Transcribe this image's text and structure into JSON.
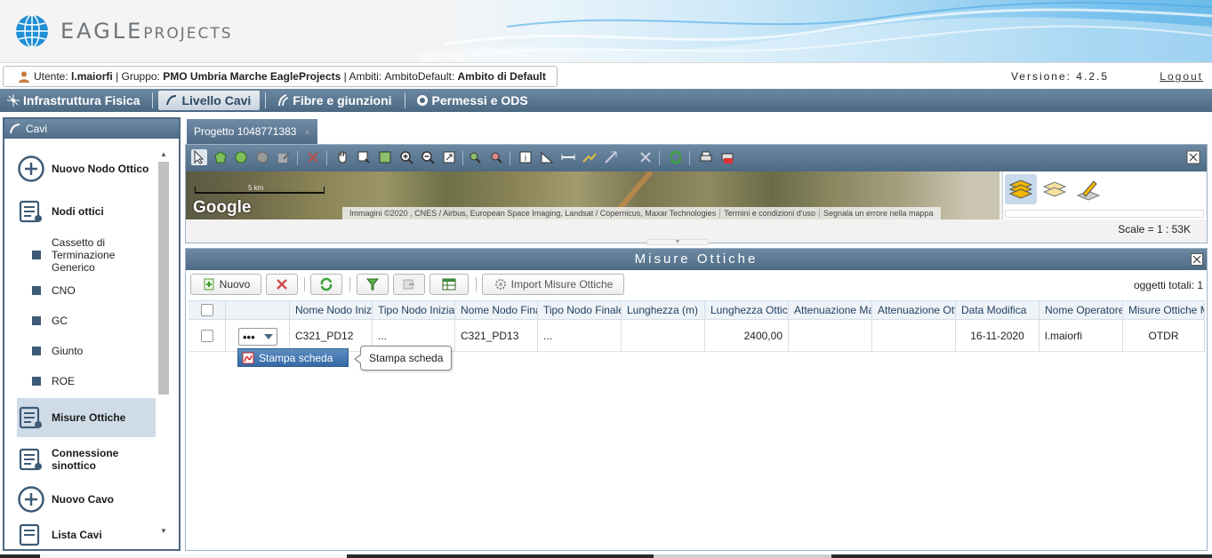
{
  "app": {
    "logo_main": "EAGLE",
    "logo_sub": "PROJECTS"
  },
  "userbar": {
    "utente_label": "Utente:",
    "utente": "l.maiorfi",
    "gruppo_label": "| Gruppo:",
    "gruppo": "PMO Umbria Marche EagleProjects",
    "ambiti_label": "| Ambiti:",
    "ambito_default_label": "AmbitoDefault:",
    "ambito_default": "Ambito di Default",
    "version": "Versione: 4.2.5",
    "logout": "Logout"
  },
  "menu": {
    "items": [
      {
        "label": "Infrastruttura Fisica",
        "icon": "network-icon"
      },
      {
        "label": "Livello Cavi",
        "icon": "cable-icon"
      },
      {
        "label": "Fibre e giunzioni",
        "icon": "fiber-icon"
      },
      {
        "label": "Permessi e ODS",
        "icon": "permit-icon"
      }
    ],
    "active": "Livello Cavi"
  },
  "leftpanel": {
    "title": "Cavi",
    "items": [
      {
        "label": "Nuovo Nodo Ottico",
        "type": "node",
        "icon": "add-circle-icon"
      },
      {
        "label": "Nodi ottici",
        "type": "node",
        "icon": "list-icon"
      },
      {
        "label": "Cassetto di Terminazione Generico",
        "type": "sub"
      },
      {
        "label": "CNO",
        "type": "sub"
      },
      {
        "label": "GC",
        "type": "sub"
      },
      {
        "label": "Giunto",
        "type": "sub"
      },
      {
        "label": "ROE",
        "type": "sub"
      },
      {
        "label": "Misure Ottiche",
        "type": "node",
        "icon": "list-icon",
        "selected": true
      },
      {
        "label": "Connessione sinottico",
        "type": "node",
        "icon": "list-icon"
      },
      {
        "label": "Nuovo Cavo",
        "type": "node",
        "icon": "add-circle-icon"
      },
      {
        "label": "Lista Cavi",
        "type": "node",
        "icon": "list-icon"
      }
    ]
  },
  "tab": {
    "label": "Progetto 1048771383",
    "close": "×"
  },
  "map": {
    "google": "Google",
    "scale_label": "5 km",
    "attribution": [
      "Immagini ©2020 , CNES / Airbus, European Space Imaging, Landsat / Copernicus, Maxar Technologies",
      "Termini e condizioni d'uso",
      "Segnala un errore nella mappa"
    ],
    "scale": "Scale = 1 : 53K"
  },
  "misure": {
    "title": "Misure Ottiche",
    "toolbar": {
      "nuovo": "Nuovo",
      "import": "Import Misure Ottiche",
      "totali": "oggetti totali: 1"
    },
    "columns": [
      "Nome Nodo Iniziale",
      "Tipo Nodo Iniziale",
      "Nome Nodo Finale",
      "Tipo Nodo Finale",
      "Lunghezza (m)",
      "Lunghezza Ottica",
      "Attenuazione Max",
      "Attenuazione Ottica",
      "Data Modifica",
      "Nome Operatore",
      "Misure Ottiche Metodo"
    ],
    "rows": [
      {
        "action": "•••",
        "nome_nodo_iniziale": "C321_PD12",
        "tipo_nodo_iniziale": "...",
        "nome_nodo_finale": "C321_PD13",
        "tipo_nodo_finale": "...",
        "lunghezza": "",
        "lunghezza_ottica": "2400,00",
        "attenuazione_max": "",
        "attenuazione_ottica": "",
        "data_modifica": "16-11-2020",
        "nome_operatore": "l.maiorfi",
        "metodo": "OTDR"
      }
    ],
    "dropdown_item": "Stampa scheda",
    "tooltip": "Stampa scheda"
  },
  "colors": {
    "header_bar": "#4c6983",
    "accent": "#356aa5",
    "selected_row": "#cfdce8"
  }
}
